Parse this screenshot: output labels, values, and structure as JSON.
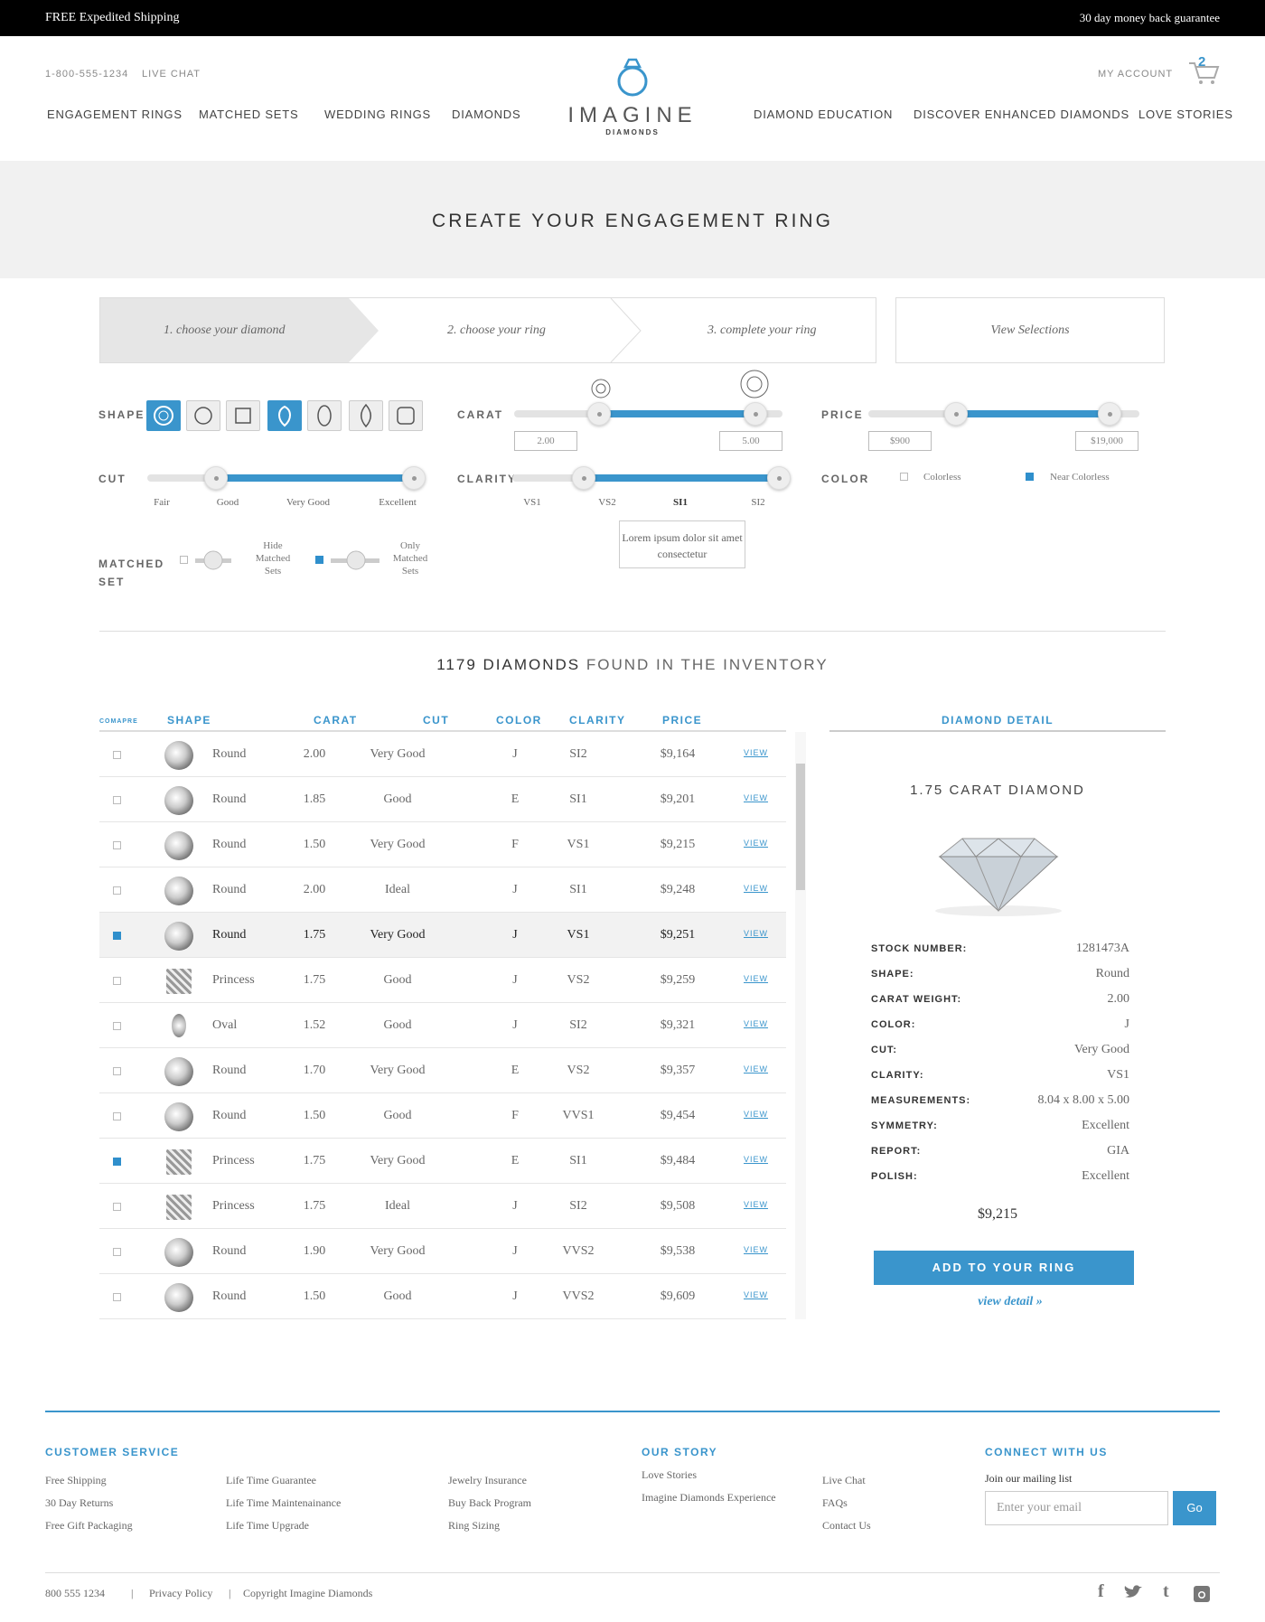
{
  "topbar": {
    "left": "FREE Expedited Shipping",
    "right": "30 day money back guarantee"
  },
  "header": {
    "phone": "1-800-555-1234",
    "live_chat": "LIVE CHAT",
    "my_account": "MY ACCOUNT",
    "cart_count": "2",
    "logo_word": "IMAGINE",
    "logo_sub": "DIAMONDS",
    "nav_left": [
      "ENGAGEMENT RINGS",
      "MATCHED SETS",
      "WEDDING RINGS",
      "DIAMONDS"
    ],
    "nav_right": [
      "DIAMOND EDUCATION",
      "DISCOVER ENHANCED DIAMONDS",
      "LOVE STORIES"
    ]
  },
  "banner": {
    "title": "CREATE YOUR ENGAGEMENT RING"
  },
  "steps": [
    "1. choose your diamond",
    "2. choose your ring",
    "3. complete your ring"
  ],
  "view_selections": "View Selections",
  "filters": {
    "shape_label": "SHAPE",
    "carat_label": "CARAT",
    "price_label": "PRICE",
    "cut_label": "CUT",
    "clarity_label": "CLARITY",
    "color_label": "COLOR",
    "matched_label": "MATCHED SET",
    "carat_min": "2.00",
    "carat_max": "5.00",
    "price_min": "$900",
    "price_max": "$19,000",
    "cut_ticks": [
      "Fair",
      "Good",
      "Very Good",
      "Excellent"
    ],
    "clarity_ticks": [
      "VS1",
      "VS2",
      "SI1",
      "SI2"
    ],
    "color_options": [
      "Colorless",
      "Near Colorless"
    ],
    "matched_options": [
      "Hide Matched Sets",
      "Only Matched Sets"
    ],
    "tooltip": "Lorem ipsum dolor sit amet consectetur"
  },
  "inventory": {
    "count": "1179 DIAMONDS",
    "suffix": "FOUND IN THE INVENTORY"
  },
  "table": {
    "headers": {
      "compare": "COMAPRE",
      "shape": "SHAPE",
      "carat": "CARAT",
      "cut": "CUT",
      "color": "COLOR",
      "clarity": "CLARITY",
      "price": "PRICE"
    },
    "view_label": "VIEW",
    "rows": [
      {
        "shape": "Round",
        "carat": "2.00",
        "cut": "Very Good",
        "color": "J",
        "clarity": "SI2",
        "price": "$9,164"
      },
      {
        "shape": "Round",
        "carat": "1.85",
        "cut": "Good",
        "color": "E",
        "clarity": "SI1",
        "price": "$9,201"
      },
      {
        "shape": "Round",
        "carat": "1.50",
        "cut": "Very Good",
        "color": "F",
        "clarity": "VS1",
        "price": "$9,215"
      },
      {
        "shape": "Round",
        "carat": "2.00",
        "cut": "Ideal",
        "color": "J",
        "clarity": "SI1",
        "price": "$9,248"
      },
      {
        "shape": "Round",
        "carat": "1.75",
        "cut": "Very Good",
        "color": "J",
        "clarity": "VS1",
        "price": "$9,251"
      },
      {
        "shape": "Princess",
        "carat": "1.75",
        "cut": "Good",
        "color": "J",
        "clarity": "VS2",
        "price": "$9,259"
      },
      {
        "shape": "Oval",
        "carat": "1.52",
        "cut": "Good",
        "color": "J",
        "clarity": "SI2",
        "price": "$9,321"
      },
      {
        "shape": "Round",
        "carat": "1.70",
        "cut": "Very Good",
        "color": "E",
        "clarity": "VS2",
        "price": "$9,357"
      },
      {
        "shape": "Round",
        "carat": "1.50",
        "cut": "Good",
        "color": "F",
        "clarity": "VVS1",
        "price": "$9,454"
      },
      {
        "shape": "Princess",
        "carat": "1.75",
        "cut": "Very Good",
        "color": "E",
        "clarity": "SI1",
        "price": "$9,484"
      },
      {
        "shape": "Princess",
        "carat": "1.75",
        "cut": "Ideal",
        "color": "J",
        "clarity": "SI2",
        "price": "$9,508"
      },
      {
        "shape": "Round",
        "carat": "1.90",
        "cut": "Very Good",
        "color": "J",
        "clarity": "VVS2",
        "price": "$9,538"
      },
      {
        "shape": "Round",
        "carat": "1.50",
        "cut": "Good",
        "color": "J",
        "clarity": "VVS2",
        "price": "$9,609"
      }
    ]
  },
  "detail": {
    "header": "DIAMOND DETAIL",
    "title": "1.75 CARAT DIAMOND",
    "fields": [
      {
        "k": "STOCK NUMBER:",
        "v": "1281473A"
      },
      {
        "k": "SHAPE:",
        "v": "Round"
      },
      {
        "k": "CARAT WEIGHT:",
        "v": "2.00"
      },
      {
        "k": "COLOR:",
        "v": "J"
      },
      {
        "k": "CUT:",
        "v": "Very Good"
      },
      {
        "k": "CLARITY:",
        "v": "VS1"
      },
      {
        "k": "MEASUREMENTS:",
        "v": "8.04 x 8.00 x 5.00"
      },
      {
        "k": "SYMMETRY:",
        "v": "Excellent"
      },
      {
        "k": "REPORT:",
        "v": "GIA"
      },
      {
        "k": "POLISH:",
        "v": "Excellent"
      }
    ],
    "price": "$9,215",
    "add_button": "ADD TO YOUR RING",
    "view_detail": "view detail »"
  },
  "footer": {
    "customer_service": "CUSTOMER SERVICE",
    "our_story": "OUR STORY",
    "connect": "CONNECT WITH US",
    "col1": [
      "Free Shipping",
      "30 Day Returns",
      "Free Gift Packaging"
    ],
    "col2": [
      "Life Time Guarantee",
      "Life Time Maintenainance",
      "Life Time Upgrade"
    ],
    "col3": [
      "Jewelry Insurance",
      "Buy Back Program",
      "Ring Sizing"
    ],
    "col4": [
      "Love Stories",
      "Imagine Diamonds Experience"
    ],
    "col5": [
      "Live Chat",
      "FAQs",
      "Contact Us"
    ],
    "mailing": "Join our mailing list",
    "email_placeholder": "Enter your email",
    "go": "Go",
    "phone": "800  555  1234",
    "privacy": "Privacy Policy",
    "copyright": "Copyright Imagine Diamonds",
    "sep": "|"
  }
}
